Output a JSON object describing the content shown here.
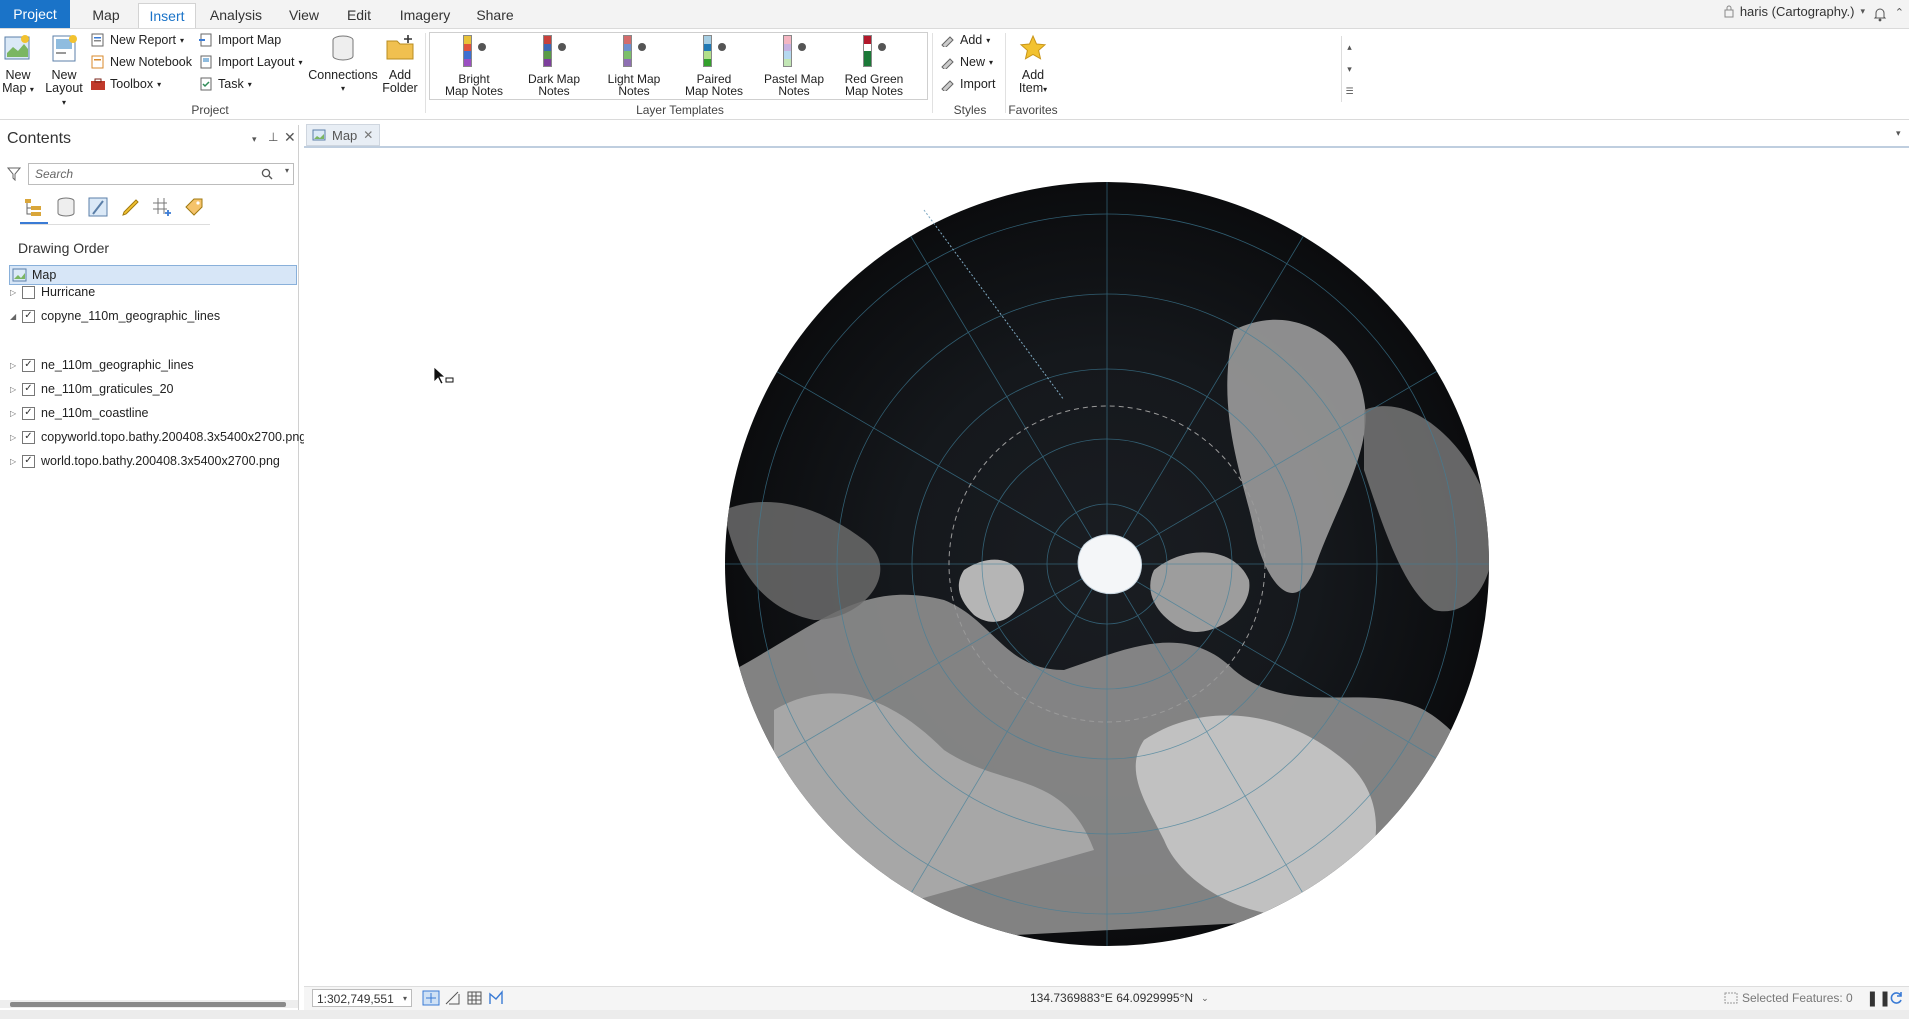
{
  "tabs": [
    {
      "label": "Project",
      "kind": "project"
    },
    {
      "label": "Map",
      "kind": "normal"
    },
    {
      "label": "Insert",
      "kind": "active"
    },
    {
      "label": "Analysis",
      "kind": "normal"
    },
    {
      "label": "View",
      "kind": "normal"
    },
    {
      "label": "Edit",
      "kind": "normal"
    },
    {
      "label": "Imagery",
      "kind": "normal"
    },
    {
      "label": "Share",
      "kind": "normal"
    }
  ],
  "user": {
    "label": "haris (Cartography.)"
  },
  "ribbon": {
    "project_group": {
      "new_map": [
        "New",
        "Map"
      ],
      "new_layout": [
        "New",
        "Layout"
      ],
      "new_report": "New Report",
      "new_notebook": "New Notebook",
      "toolbox": "Toolbox",
      "import_map": "Import Map",
      "import_layout": "Import Layout",
      "task": "Task",
      "connections": "Connections",
      "add_folder": [
        "Add",
        "Folder"
      ],
      "label": "Project"
    },
    "layer_templates": {
      "items": [
        {
          "l1": "Bright",
          "l2": "Map Notes",
          "colors": [
            "#e8c23a",
            "#e0523d",
            "#3e6fd1",
            "#9b4fc2"
          ]
        },
        {
          "l1": "Dark Map",
          "l2": "Notes",
          "colors": [
            "#c8403b",
            "#3d66b5",
            "#5a9b46",
            "#7d3f9c"
          ]
        },
        {
          "l1": "Light Map",
          "l2": "Notes",
          "colors": [
            "#d36c6c",
            "#6f8fce",
            "#7cbf6a",
            "#8e6fb2"
          ]
        },
        {
          "l1": "Paired",
          "l2": "Map Notes",
          "colors": [
            "#a6cee3",
            "#1f78b4",
            "#b2df8a",
            "#33a02c"
          ]
        },
        {
          "l1": "Pastel Map",
          "l2": "Notes",
          "colors": [
            "#f4b6c2",
            "#c7b2e0",
            "#b5d8f0",
            "#c2e6b5"
          ]
        },
        {
          "l1": "Red Green",
          "l2": "Map Notes",
          "colors": [
            "#b2182b",
            "#ffffff",
            "#1b7837",
            "#1b7837"
          ]
        }
      ],
      "label": "Layer Templates"
    },
    "styles": {
      "add": "Add",
      "new": "New",
      "import": "Import",
      "label": "Styles"
    },
    "favorites": {
      "add_item": [
        "Add",
        "Item"
      ],
      "label": "Favorites"
    }
  },
  "contents": {
    "title": "Contents",
    "search_placeholder": "Search",
    "drawing_order": "Drawing Order",
    "map_node": "Map",
    "layers": [
      {
        "name": "Hurricane",
        "checked": false,
        "expanded": false
      },
      {
        "name": "copyne_110m_geographic_lines",
        "checked": true,
        "expanded": true
      },
      {
        "name": "ne_110m_geographic_lines",
        "checked": true,
        "expanded": false
      },
      {
        "name": "ne_110m_graticules_20",
        "checked": true,
        "expanded": false
      },
      {
        "name": "ne_110m_coastline",
        "checked": true,
        "expanded": false
      },
      {
        "name": "copyworld.topo.bathy.200408.3x5400x2700.png",
        "checked": true,
        "expanded": false
      },
      {
        "name": "world.topo.bathy.200408.3x5400x2700.png",
        "checked": true,
        "expanded": false
      }
    ]
  },
  "map_tab": {
    "label": "Map"
  },
  "status": {
    "scale": "1:302,749,551",
    "coords": "134.7369883°E 64.0929995°N",
    "selected": "Selected Features: 0"
  }
}
